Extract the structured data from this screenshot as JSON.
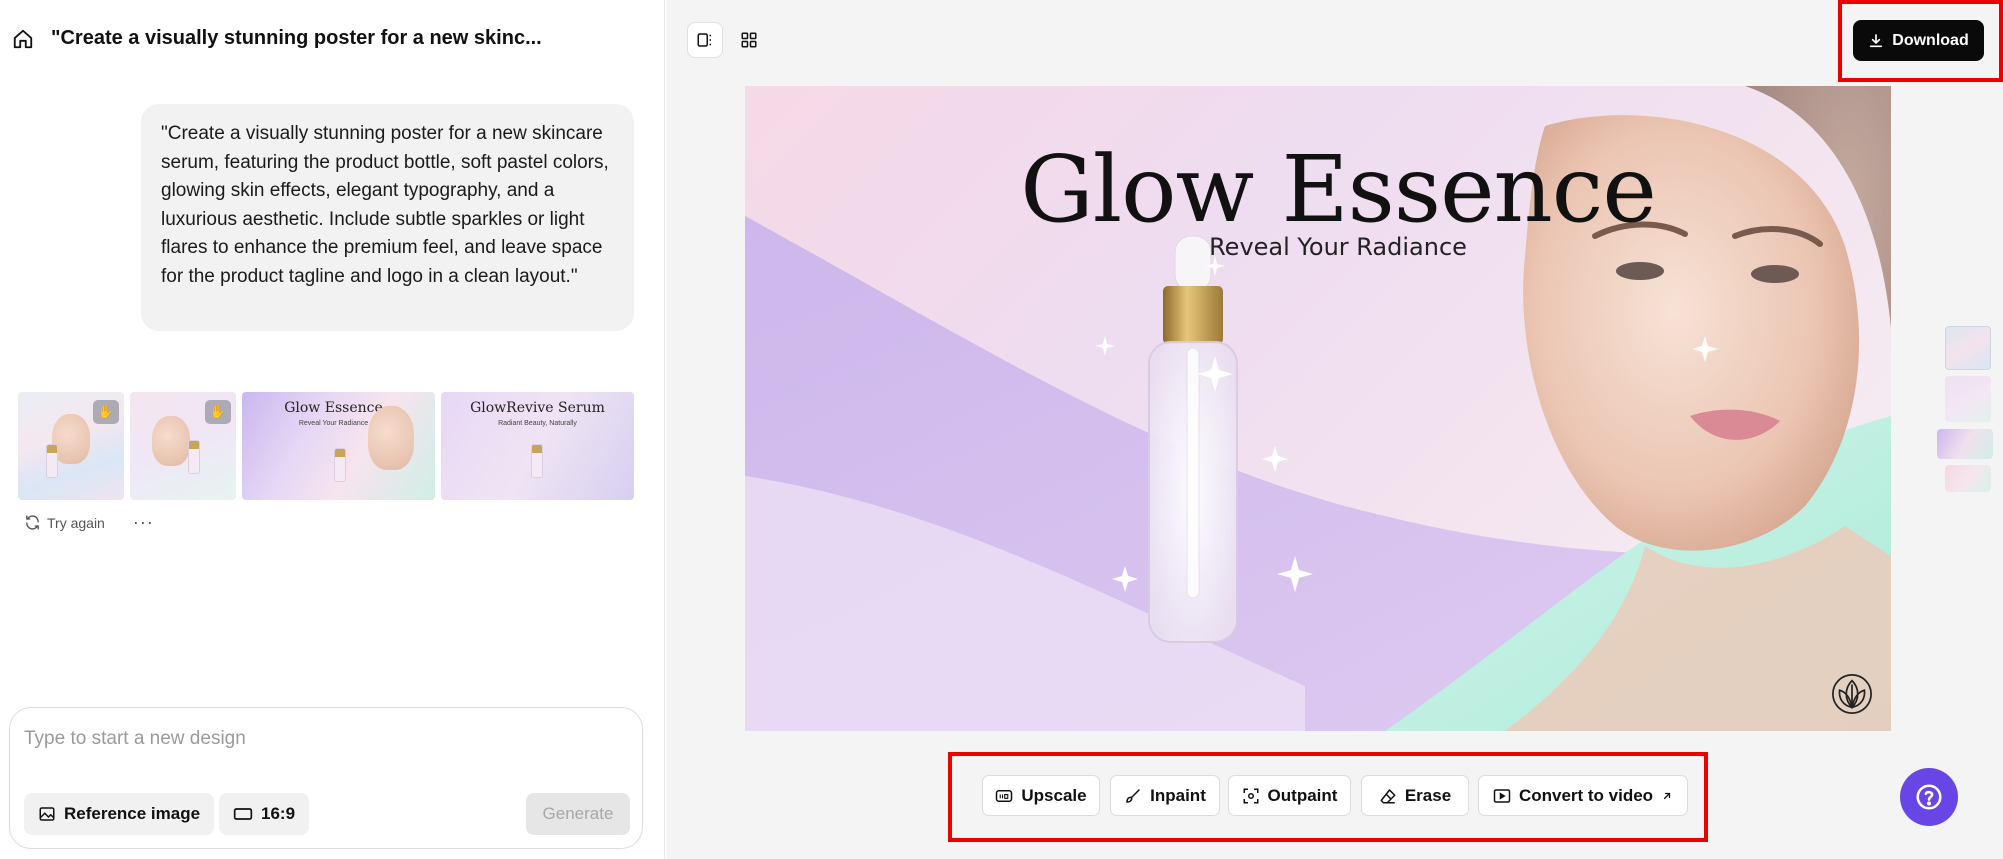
{
  "header": {
    "title": "\"Create a visually stunning poster for a new skinc..."
  },
  "prompt": {
    "text": "\"Create a visually stunning poster for a new skincare serum, featuring the product bottle, soft pastel colors, glowing skin effects, elegant typography, and a luxurious aesthetic. Include subtle sparkles or light flares to enhance the premium feel, and leave space for the product tagline and logo in a clean layout.\""
  },
  "results": {
    "thumbnails": [
      {
        "kind": "portrait-1",
        "badge_icon": "hand-icon"
      },
      {
        "kind": "portrait-2",
        "badge_icon": "hand-icon"
      },
      {
        "kind": "landscape",
        "title": "Glow Essence",
        "subtitle": "Reveal Your Radiance"
      },
      {
        "kind": "landscape",
        "title": "GlowRevive Serum",
        "subtitle": "Radiant Beauty, Naturally"
      }
    ],
    "try_again_label": "Try again",
    "more_label": "···"
  },
  "composer": {
    "placeholder": "Type to start a new design",
    "reference_label": "Reference image",
    "ratio_label": "16:9",
    "generate_label": "Generate"
  },
  "toolbar_top": {
    "download_label": "Download"
  },
  "poster": {
    "title": "Glow Essence",
    "subtitle": "Reveal Your Radiance"
  },
  "tools": {
    "upscale": "Upscale",
    "inpaint": "Inpaint",
    "outpaint": "Outpaint",
    "erase": "Erase",
    "convert": "Convert to video"
  },
  "colors": {
    "accent_help": "#6846e6",
    "highlight": "#ee0000",
    "download_bg": "#0a0a0a"
  }
}
